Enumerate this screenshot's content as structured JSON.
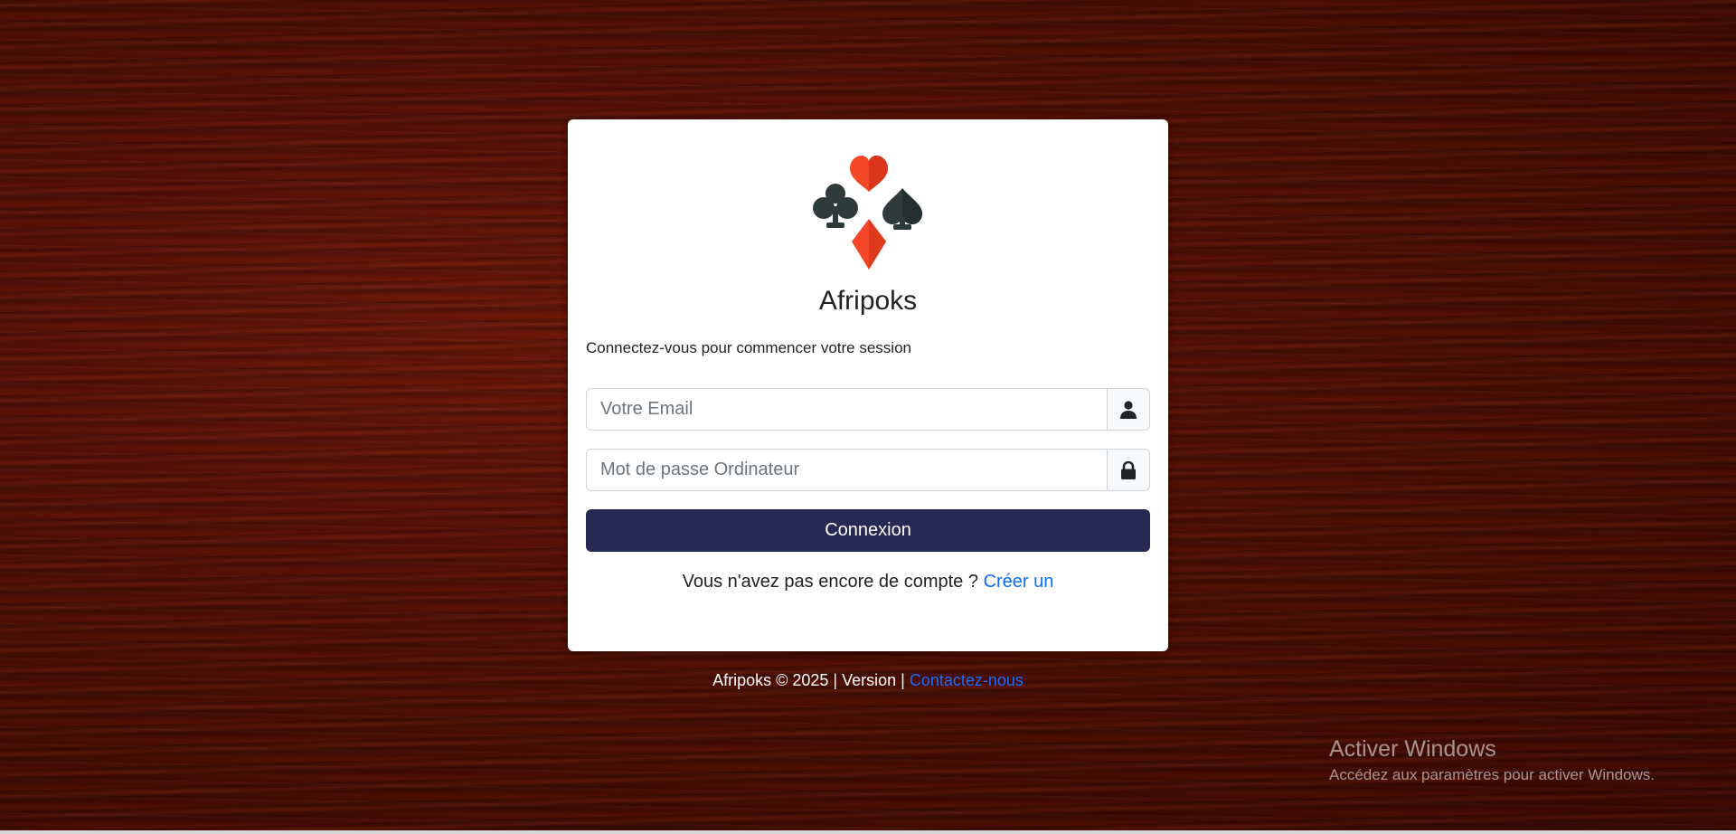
{
  "brand": {
    "name": "Afripoks",
    "logo_icon": "card-suits-logo"
  },
  "login": {
    "subtitle": "Connectez-vous pour commencer votre session",
    "email_placeholder": "Votre Email",
    "email_icon": "user-icon",
    "password_placeholder": "Mot de passe Ordinateur",
    "password_icon": "lock-icon",
    "submit_label": "Connexion",
    "register_text": "Vous n'avez pas encore de compte ?",
    "register_link": "Créer un"
  },
  "footer": {
    "copyright": "Afripoks © 2025 | Version |",
    "contact_link": "Contactez-nous"
  },
  "windows_watermark": {
    "title": "Activer Windows",
    "subtitle": "Accédez aux paramètres pour activer Windows."
  },
  "colors": {
    "primary_button": "#252a52",
    "link": "#0d6efd",
    "suit_red": "#f4472a",
    "suit_dark": "#2e3b3b"
  }
}
